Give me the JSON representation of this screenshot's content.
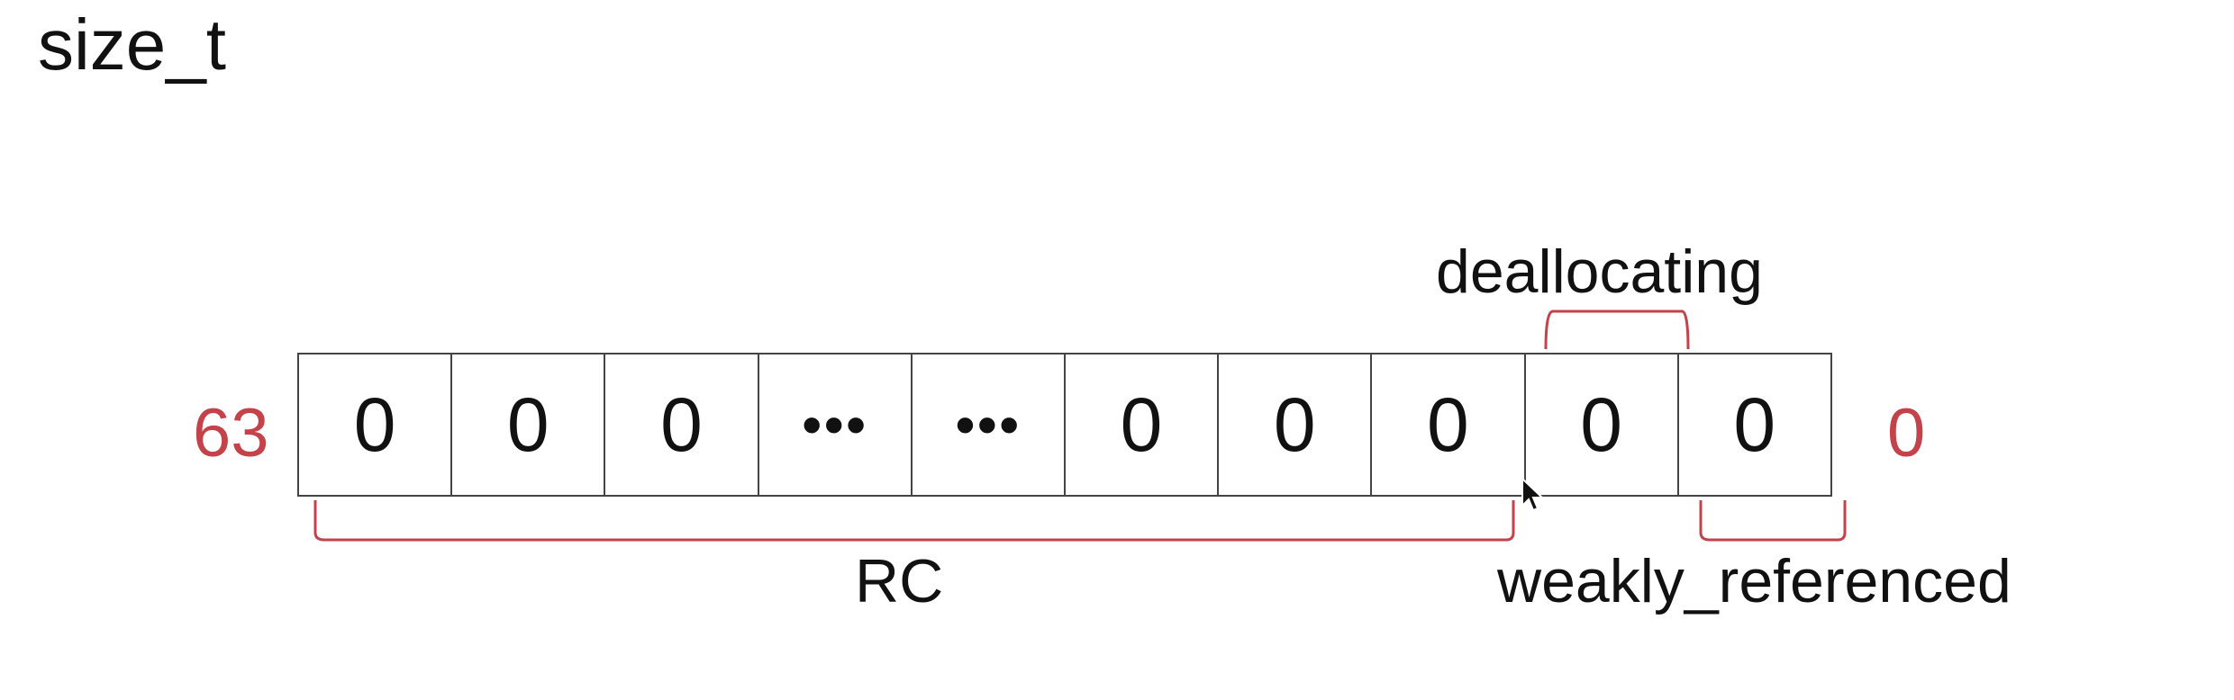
{
  "diagram": {
    "title": "size_t",
    "bit_high": "63",
    "bit_low": "0",
    "cells": [
      "0",
      "0",
      "0",
      "•••",
      "•••",
      "0",
      "0",
      "0",
      "0",
      "0"
    ],
    "labels": {
      "deallocating": "deallocating",
      "rc": "RC",
      "weakly_referenced": "weakly_referenced"
    },
    "colors": {
      "bracket": "#c4424a",
      "bit_number": "#c4424a",
      "cell_border": "#444444",
      "text": "#111111"
    }
  }
}
